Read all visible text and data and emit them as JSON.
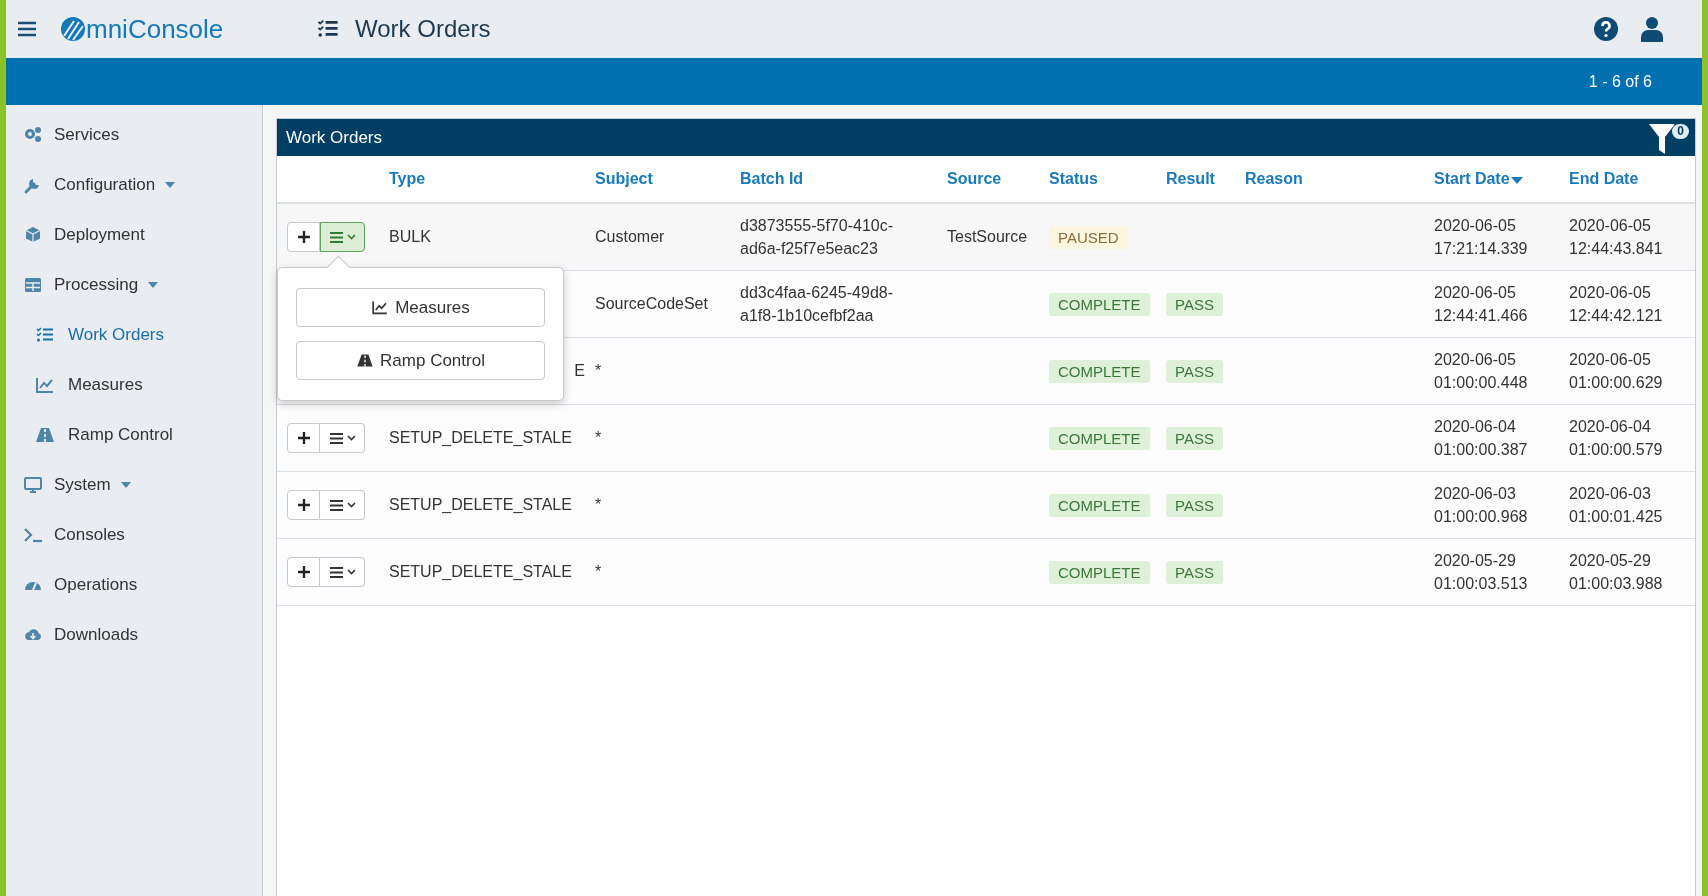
{
  "header": {
    "logo": "mniConsole",
    "title": "Work Orders"
  },
  "pager": "1 - 6 of 6",
  "sidebar": {
    "items": [
      {
        "label": "Services",
        "kind": "link",
        "selected": false
      },
      {
        "label": "Configuration",
        "kind": "group",
        "selected": false
      },
      {
        "label": "Deployment",
        "kind": "link",
        "selected": false
      },
      {
        "label": "Processing",
        "kind": "group",
        "selected": false,
        "children": [
          {
            "label": "Work Orders",
            "selected": true
          },
          {
            "label": "Measures",
            "selected": false
          },
          {
            "label": "Ramp Control",
            "selected": false
          }
        ]
      },
      {
        "label": "System",
        "kind": "group",
        "selected": false
      },
      {
        "label": "Consoles",
        "kind": "link",
        "selected": false
      },
      {
        "label": "Operations",
        "kind": "link",
        "selected": false
      },
      {
        "label": "Downloads",
        "kind": "link",
        "selected": false
      }
    ]
  },
  "panel": {
    "title": "Work Orders",
    "filter_count": "0"
  },
  "table": {
    "columns": [
      {
        "label": "Type",
        "sorted": false
      },
      {
        "label": "Subject",
        "sorted": false
      },
      {
        "label": "Batch Id",
        "sorted": false
      },
      {
        "label": "Source",
        "sorted": false
      },
      {
        "label": "Status",
        "sorted": false
      },
      {
        "label": "Result",
        "sorted": false
      },
      {
        "label": "Reason",
        "sorted": false
      },
      {
        "label": "Start Date",
        "sorted": true
      },
      {
        "label": "End Date",
        "sorted": false
      }
    ],
    "rows": [
      {
        "kind": "open",
        "type": "BULK",
        "subject": "Customer",
        "batch_id": "d3873555-5f70-410c-ad6a-f25f7e5eac23",
        "source": "TestSource",
        "status": {
          "text": "PAUSED",
          "kind": "warning"
        },
        "start_date": "2020-06-05 17:21:14.339",
        "end_date": "2020-06-05 12:44:43.841"
      },
      {
        "kind": "covered",
        "subject": "SourceCodeSet",
        "batch_id": "dd3c4faa-6245-49d8-a1f8-1b10cefbf2aa",
        "status": {
          "text": "COMPLETE",
          "kind": "success"
        },
        "result": {
          "text": "PASS",
          "kind": "success"
        },
        "start_date": "2020-06-05 12:44:41.466",
        "end_date": "2020-06-05 12:44:42.121"
      },
      {
        "kind": "covered",
        "type": "E",
        "subject": "*",
        "status": {
          "text": "COMPLETE",
          "kind": "success"
        },
        "result": {
          "text": "PASS",
          "kind": "success"
        },
        "start_date": "2020-06-05 01:00:00.448",
        "end_date": "2020-06-05 01:00:00.629"
      },
      {
        "kind": "closed",
        "type": "SETUP_DELETE_STALE",
        "subject": "*",
        "status": {
          "text": "COMPLETE",
          "kind": "success"
        },
        "result": {
          "text": "PASS",
          "kind": "success"
        },
        "start_date": "2020-06-04 01:00:00.387",
        "end_date": "2020-06-04 01:00:00.579"
      },
      {
        "kind": "closed",
        "type": "SETUP_DELETE_STALE",
        "subject": "*",
        "status": {
          "text": "COMPLETE",
          "kind": "success"
        },
        "result": {
          "text": "PASS",
          "kind": "success"
        },
        "start_date": "2020-06-03 01:00:00.968",
        "end_date": "2020-06-03 01:00:01.425"
      },
      {
        "kind": "closed",
        "type": "SETUP_DELETE_STALE",
        "subject": "*",
        "status": {
          "text": "COMPLETE",
          "kind": "success"
        },
        "result": {
          "text": "PASS",
          "kind": "success"
        },
        "start_date": "2020-05-29 01:00:03.513",
        "end_date": "2020-05-29 01:00:03.988"
      }
    ]
  },
  "row_menu": {
    "items": [
      "Measures",
      "Ramp Control"
    ]
  }
}
